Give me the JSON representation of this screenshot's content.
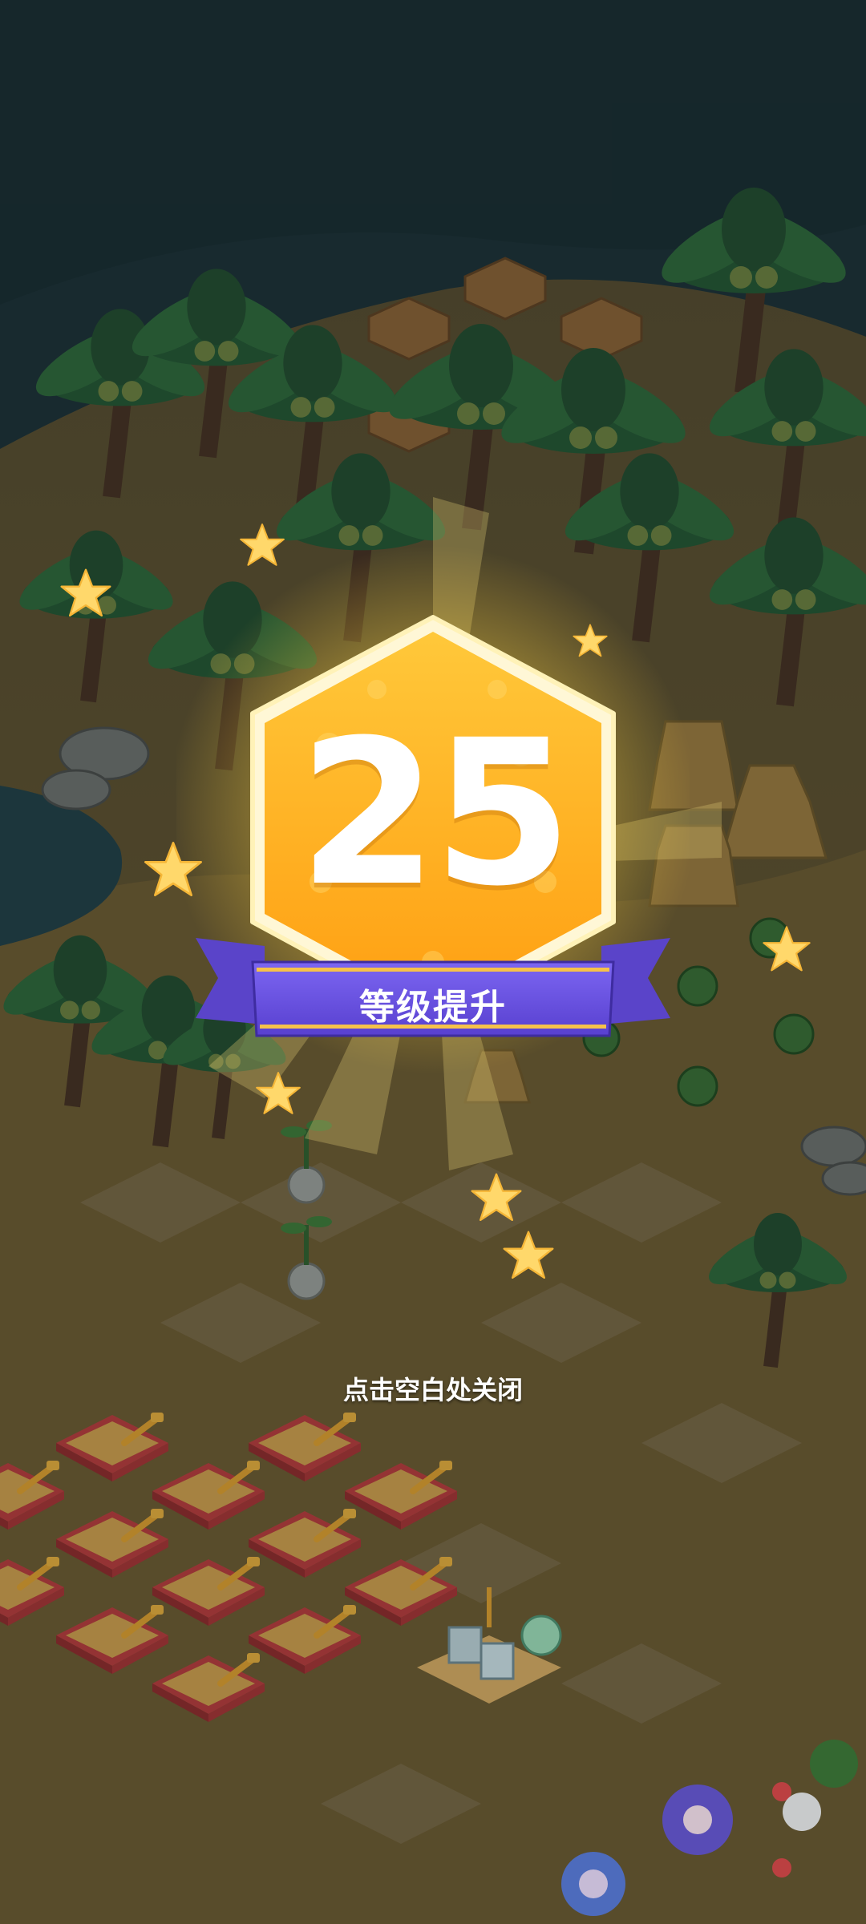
{
  "level_up": {
    "level": "25",
    "title": "等级提升"
  },
  "close_hint": "点击空白处关闭",
  "colors": {
    "sky": "#1f3438",
    "badge_gold": "#ffb21c",
    "ribbon_purple": "#6a52e0",
    "sand": "#a8823e"
  }
}
